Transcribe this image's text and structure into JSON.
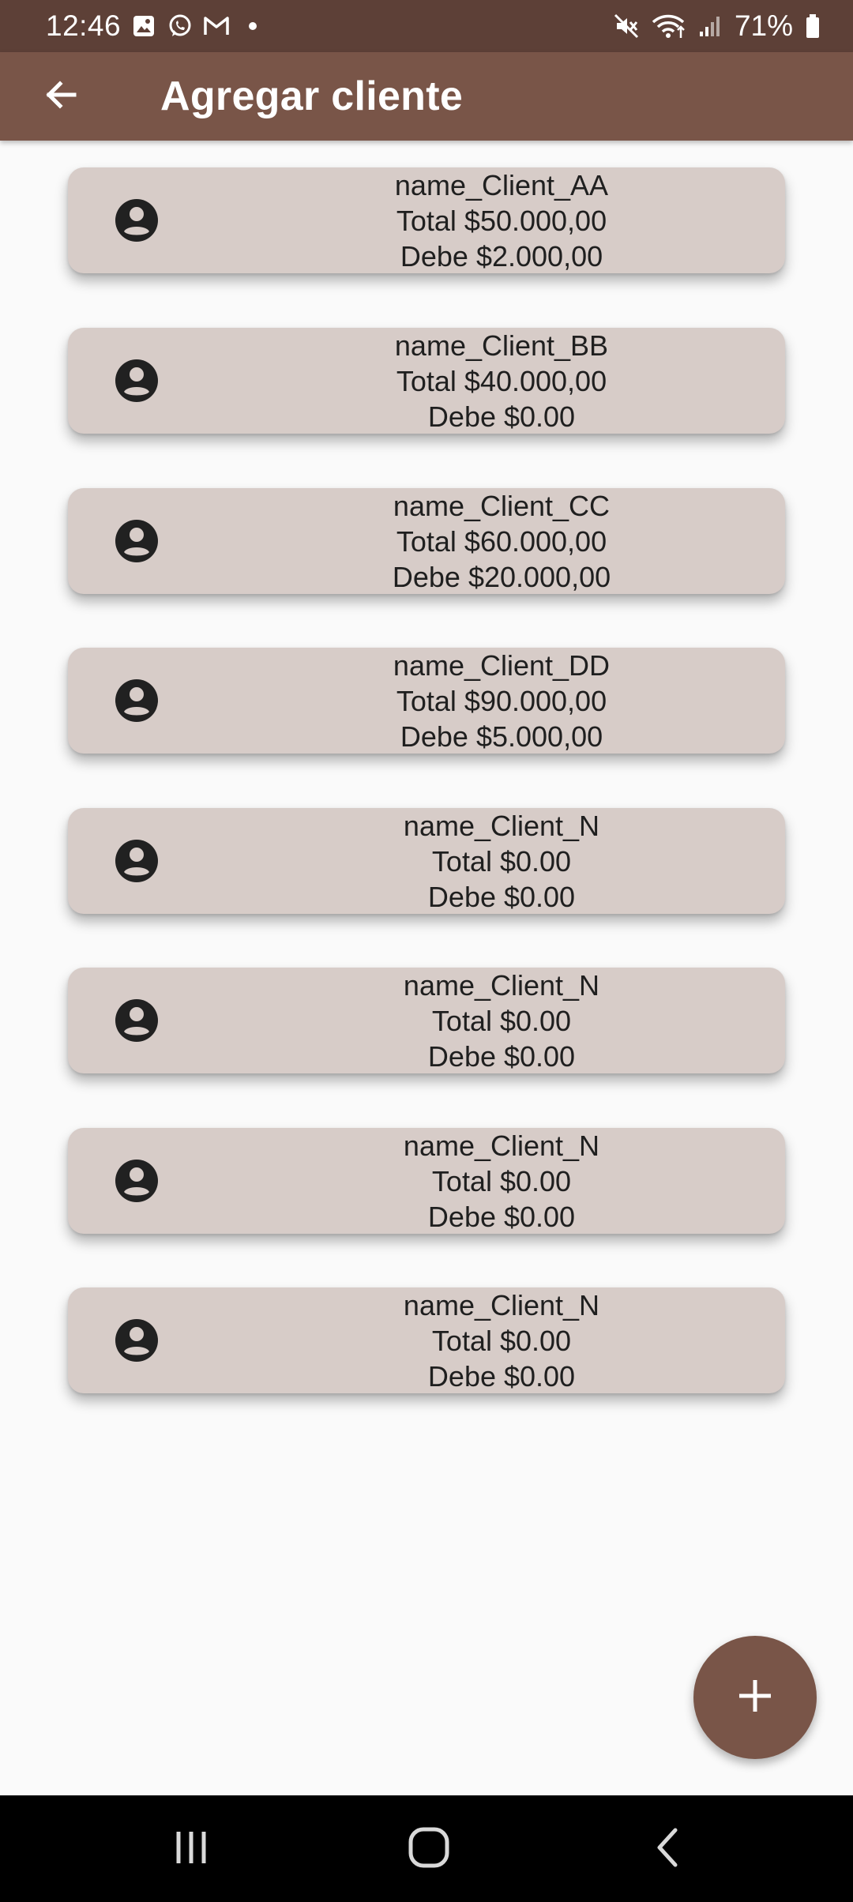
{
  "status_bar": {
    "time": "12:46",
    "battery": "71%",
    "icons_left": [
      "image-icon",
      "whatsapp-icon",
      "gmail-icon",
      "dot-icon"
    ],
    "icons_right": [
      "mute-icon",
      "wifi-icon",
      "signal-icon",
      "battery-icon"
    ]
  },
  "app_bar": {
    "title": "Agregar cliente",
    "back_icon": "arrow-left-icon"
  },
  "clients": [
    {
      "name": "name_Client_AA",
      "total": "Total $50.000,00",
      "debe": "Debe $2.000,00"
    },
    {
      "name": "name_Client_BB",
      "total": "Total $40.000,00",
      "debe": "Debe $0.00"
    },
    {
      "name": "name_Client_CC",
      "total": "Total $60.000,00",
      "debe": "Debe $20.000,00"
    },
    {
      "name": "name_Client_DD",
      "total": "Total $90.000,00",
      "debe": "Debe $5.000,00"
    },
    {
      "name": "name_Client_N",
      "total": "Total $0.00",
      "debe": "Debe $0.00"
    },
    {
      "name": "name_Client_N",
      "total": "Total $0.00",
      "debe": "Debe $0.00"
    },
    {
      "name": "name_Client_N",
      "total": "Total $0.00",
      "debe": "Debe $0.00"
    },
    {
      "name": "name_Client_N",
      "total": "Total $0.00",
      "debe": "Debe $0.00"
    }
  ],
  "fab": {
    "icon": "plus-icon"
  },
  "colors": {
    "status_bar": "#5d4037",
    "app_bar": "#795548",
    "card": "#d7ccc8",
    "background": "#fafafa",
    "fab": "#795548"
  },
  "nav_bar": {
    "icons": [
      "recent-apps-icon",
      "home-icon",
      "back-icon"
    ]
  }
}
